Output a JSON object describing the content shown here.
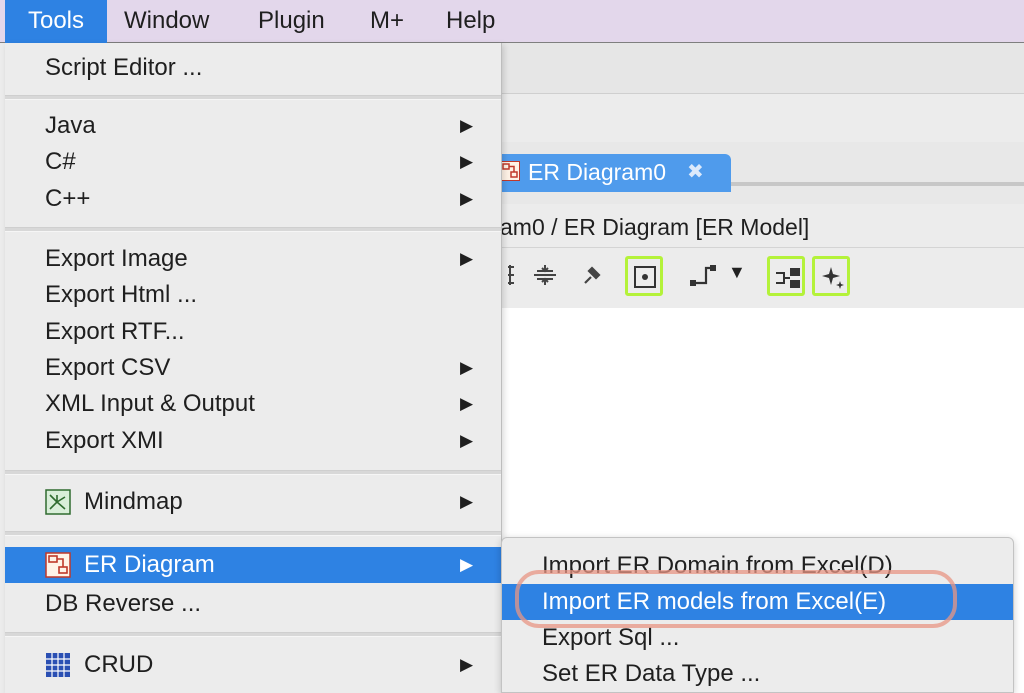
{
  "menubar": {
    "items": [
      {
        "label": "Tools",
        "active": true
      },
      {
        "label": "Window",
        "active": false
      },
      {
        "label": "Plugin",
        "active": false
      },
      {
        "label": "M+",
        "active": false
      },
      {
        "label": "Help",
        "active": false
      }
    ]
  },
  "tools_menu": {
    "script_editor": "Script Editor ...",
    "java": "Java",
    "csharp": "C#",
    "cpp": "C++",
    "export_image": "Export Image",
    "export_html": "Export Html ...",
    "export_rtf": "Export RTF...",
    "export_csv": "Export CSV",
    "xml_io": "XML Input & Output",
    "export_xmi": "Export XMI",
    "mindmap": "Mindmap",
    "er_diagram": "ER Diagram",
    "db_reverse": "DB Reverse ...",
    "crud": "CRUD",
    "submenu_arrow": "▶"
  },
  "er_submenu": {
    "import_domain": "Import ER Domain from Excel(D)",
    "import_models": "Import ER models from Excel(E)",
    "export_sql": "Export Sql ...",
    "set_data_type": "Set ER Data Type ..."
  },
  "editor": {
    "tab_label": "ER Diagram0",
    "tab_close": "✖",
    "breadcrumb": "am0 / ER Diagram [ER Model]",
    "dropdown_caret": "▼"
  },
  "colors": {
    "menubar_bg": "#e3d7eb",
    "selection_blue": "#2e82e3",
    "tab_blue": "#4f9bec",
    "highlight_green": "#b4f23a",
    "annotation_ring": "#e89684"
  },
  "icons": {
    "er_diagram": "er-diagram-icon",
    "mindmap": "mindmap-icon",
    "crud": "crud-grid-icon"
  }
}
